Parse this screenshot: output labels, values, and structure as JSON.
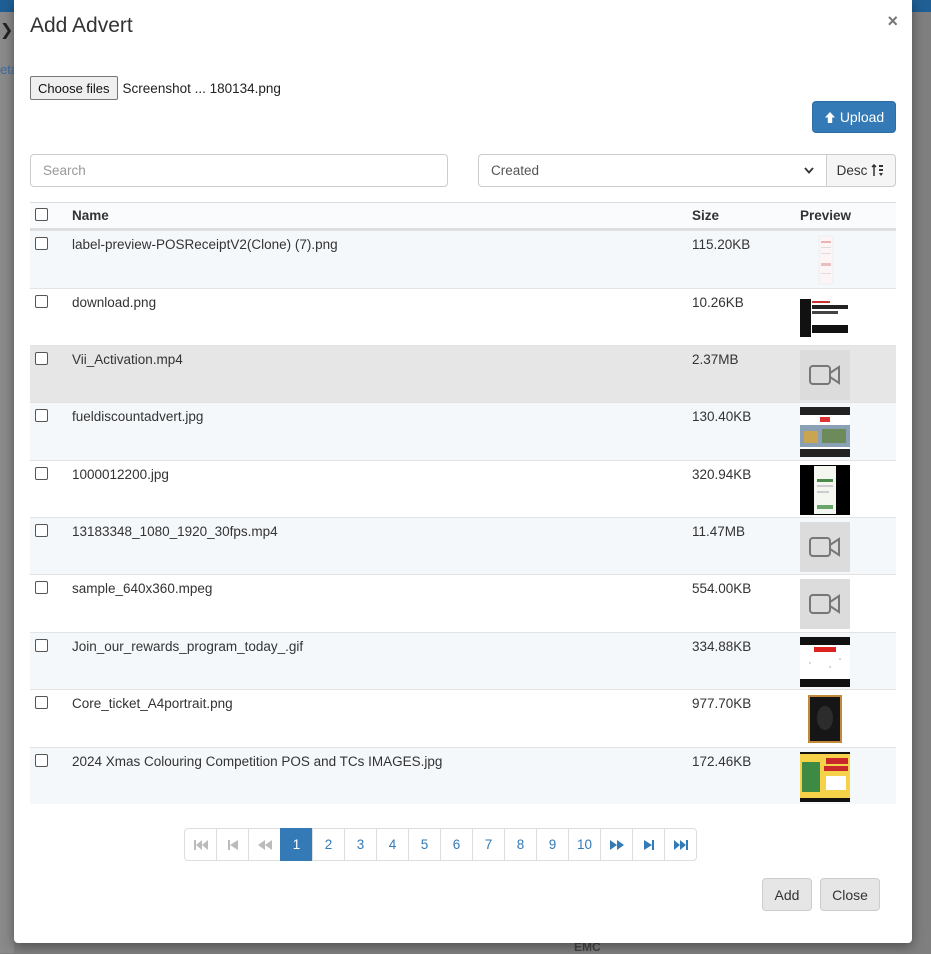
{
  "background": {
    "footer_text": "EMC",
    "side_text": "eta"
  },
  "modal": {
    "title": "Add Advert",
    "close_glyph": "×",
    "choose_label": "Choose files",
    "chosen_file": "Screenshot ... 180134.png",
    "upload_label": "Upload",
    "search_placeholder": "Search",
    "sort_value": "Created",
    "order_label": "Desc"
  },
  "table": {
    "headers": {
      "name": "Name",
      "size": "Size",
      "preview": "Preview"
    },
    "rows": [
      {
        "name": "label-preview-POSReceiptV2(Clone) (7).png",
        "size": "115.20KB",
        "preview": "receipt"
      },
      {
        "name": "download.png",
        "size": "10.26KB",
        "preview": "price"
      },
      {
        "name": "Vii_Activation.mp4",
        "size": "2.37MB",
        "preview": "video"
      },
      {
        "name": "fueldiscountadvert.jpg",
        "size": "130.40KB",
        "preview": "fuel"
      },
      {
        "name": "1000012200.jpg",
        "size": "320.94KB",
        "preview": "phone"
      },
      {
        "name": "13183348_1080_1920_30fps.mp4",
        "size": "11.47MB",
        "preview": "video"
      },
      {
        "name": "sample_640x360.mpeg",
        "size": "554.00KB",
        "preview": "video"
      },
      {
        "name": "Join_our_rewards_program_today_.gif",
        "size": "334.88KB",
        "preview": "rewards"
      },
      {
        "name": "Core_ticket_A4portrait.png",
        "size": "977.70KB",
        "preview": "ticket"
      },
      {
        "name": "2024 Xmas Colouring Competition POS and TCs IMAGES.jpg",
        "size": "172.46KB",
        "preview": "xmas"
      }
    ]
  },
  "pagination": {
    "pages": [
      "1",
      "2",
      "3",
      "4",
      "5",
      "6",
      "7",
      "8",
      "9",
      "10"
    ],
    "current": "1"
  },
  "footer": {
    "add_label": "Add",
    "close_label": "Close"
  },
  "colors": {
    "primary": "#337ab7",
    "highlight_row": "#e6e6e6",
    "stripe_row": "#f5f8fb"
  }
}
